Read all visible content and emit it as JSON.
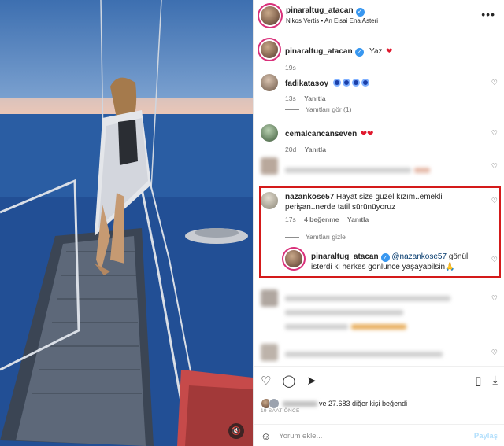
{
  "post": {
    "username": "pinaraltug_atacan",
    "audio": "Nikos Vertis • An Eisai Ena Asteri",
    "caption_text": "Yaz",
    "caption_emoji": "❤",
    "caption_time": "19s",
    "more": "•••"
  },
  "comments": [
    {
      "username": "fadikatasoy",
      "time": "13s",
      "reply": "Yanıtla",
      "view_replies": "Yanıtları gör (1)"
    },
    {
      "username": "cemalcancanseven",
      "emoji": "❤❤",
      "time": "20d",
      "reply": "Yanıtla"
    },
    {
      "username": "nazankose57",
      "text": "Hayat size güzel kızım..emekli perişan..nerde tatil sürünüyoruz",
      "time": "17s",
      "likes": "4 beğenme",
      "reply": "Yanıtla",
      "hide_replies": "Yanıtları gizle"
    },
    {
      "username": "pinaraltug_atacan",
      "mention": "@nazankose57",
      "text": "gönül isterdi ki herkes gönlünce yaşayabilsin",
      "emoji": "🙏"
    }
  ],
  "actions": {
    "liked_by_suffix": "ve 27.683 diğer kişi beğendi",
    "date": "19 SAAT ÖNCE",
    "comment_placeholder": "Yorum ekle...",
    "share": "Paylaş"
  },
  "colors": {
    "highlight": "#d41a1a",
    "verified": "#3897f0",
    "heart": "#e0182d"
  }
}
